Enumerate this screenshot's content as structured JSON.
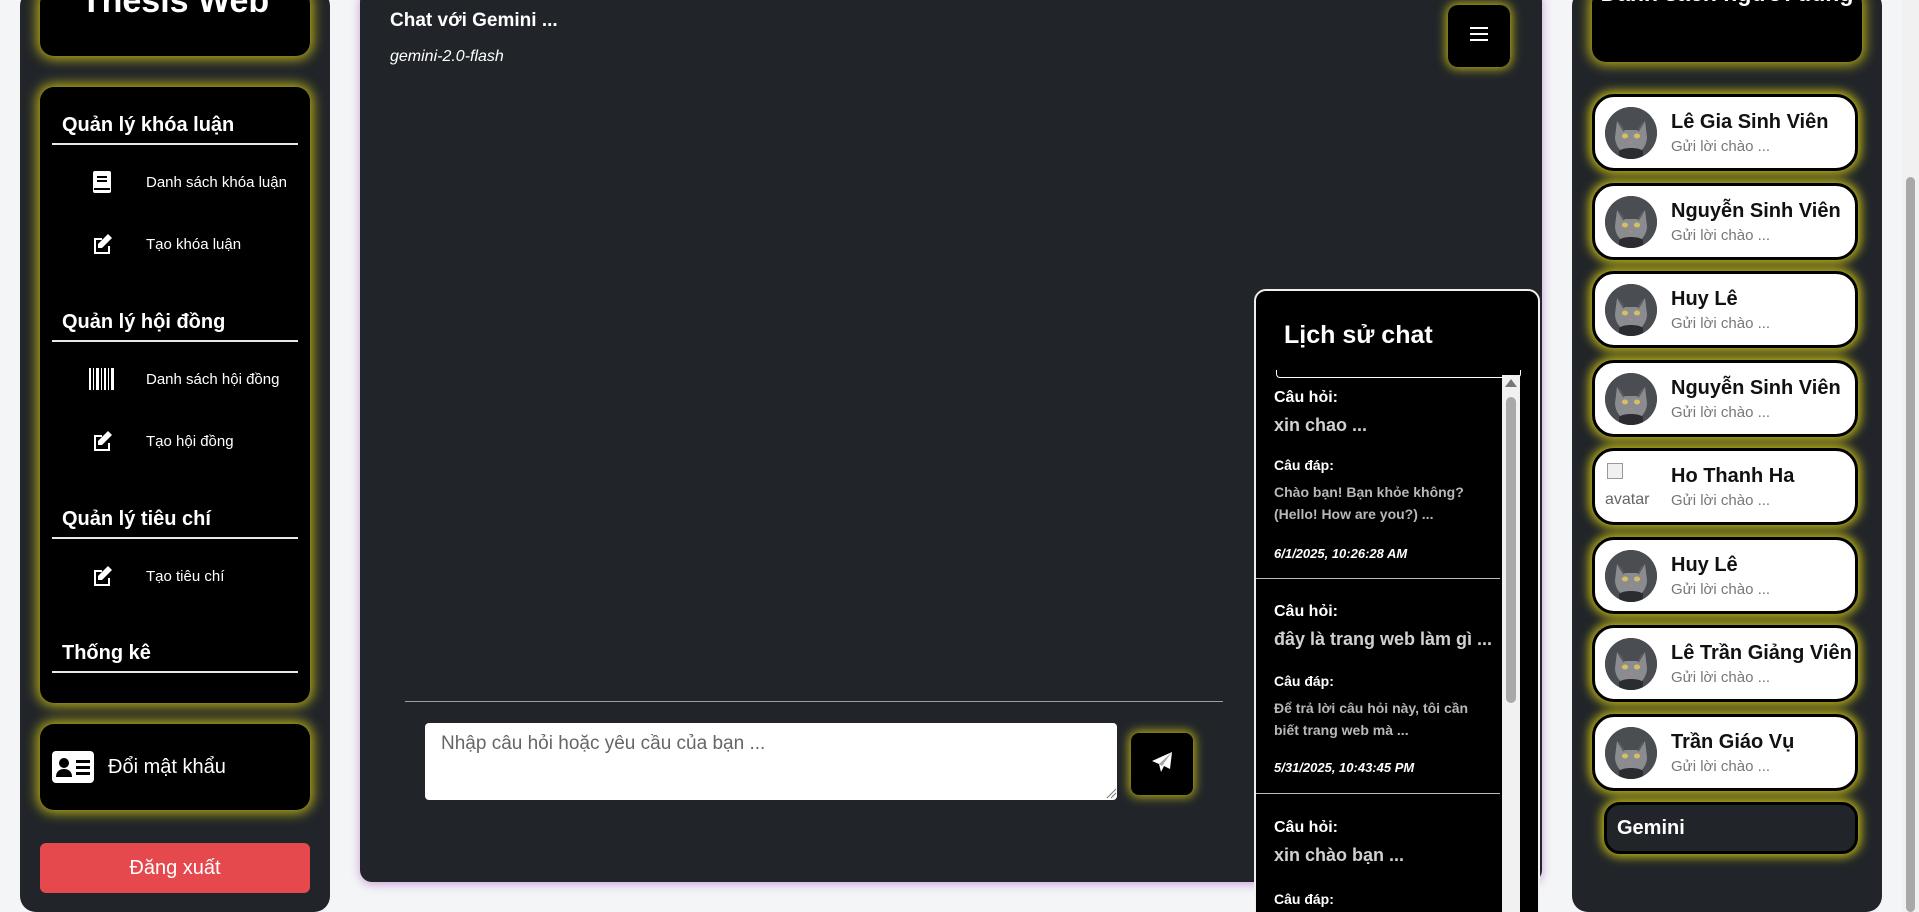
{
  "app": {
    "brand": "Thesis Web"
  },
  "sidebar": {
    "sections": [
      {
        "title": "Quản lý khóa luận",
        "items": [
          {
            "label": "Danh sách khóa luận",
            "icon": "book-icon"
          },
          {
            "label": "Tạo khóa luận",
            "icon": "edit-icon"
          }
        ]
      },
      {
        "title": "Quản lý hội đồng",
        "items": [
          {
            "label": "Danh sách hội đồng",
            "icon": "barcode-icon"
          },
          {
            "label": "Tạo hội đồng",
            "icon": "edit-icon"
          }
        ]
      },
      {
        "title": "Quản lý tiêu chí",
        "items": [
          {
            "label": "Tạo tiêu chí",
            "icon": "edit-icon"
          }
        ]
      },
      {
        "title": "Thống kê",
        "items": []
      }
    ],
    "change_password": {
      "label": "Đổi mật khẩu",
      "icon": "id-card-icon"
    },
    "logout": {
      "label": "Đăng xuất",
      "color": "#e5484d"
    }
  },
  "chat": {
    "title": "Chat với Gemini ...",
    "model": "gemini-2.0-flash",
    "input_placeholder": "Nhập câu hỏi hoặc yêu cầu của bạn ...",
    "input_value": "",
    "menu_icon": "hamburger-icon",
    "send_icon": "paper-plane-icon"
  },
  "history": {
    "title": "Lịch sử chat",
    "question_label": "Câu hỏi:",
    "answer_label": "Câu đáp:",
    "entries": [
      {
        "question": "xin chao ...",
        "answer": "Chào bạn! Bạn khỏe không? (Hello! How are you?) ...",
        "timestamp": "6/1/2025, 10:26:28 AM"
      },
      {
        "question": "đây là trang web làm gì ...",
        "answer": "Để trả lời câu hỏi này, tôi cần biết trang web mà ...",
        "timestamp": "5/31/2025, 10:43:45 PM"
      },
      {
        "question": "xin chào bạn ...",
        "answer": "",
        "timestamp": ""
      }
    ]
  },
  "users": {
    "title": "Danh sách người dùng",
    "items": [
      {
        "name": "Lê Gia Sinh Viên",
        "message": "Gửi lời chào ...",
        "avatar": "cat"
      },
      {
        "name": "Nguyễn Sinh Viên",
        "message": "Gửi lời chào ...",
        "avatar": "cat"
      },
      {
        "name": "Huy Lê",
        "message": "Gửi lời chào ...",
        "avatar": "cat"
      },
      {
        "name": "Nguyễn Sinh Viên",
        "message": "Gửi lời chào ...",
        "avatar": "cat"
      },
      {
        "name": "Ho Thanh Ha",
        "message": "Gửi lời chào ...",
        "avatar": "broken",
        "avatar_alt": "avatar"
      },
      {
        "name": "Huy Lê",
        "message": "Gửi lời chào ...",
        "avatar": "cat"
      },
      {
        "name": "Lê Trần Giảng Viên",
        "message": "Gửi lời chào ...",
        "avatar": "cat"
      },
      {
        "name": "Trần Giáo Vụ",
        "message": "Gửi lời chào ...",
        "avatar": "cat"
      }
    ],
    "gemini": {
      "label": "Gemini"
    }
  },
  "colors": {
    "panel": "#212529",
    "box": "#000000",
    "glow": "#d2c814",
    "danger": "#e5484d"
  }
}
